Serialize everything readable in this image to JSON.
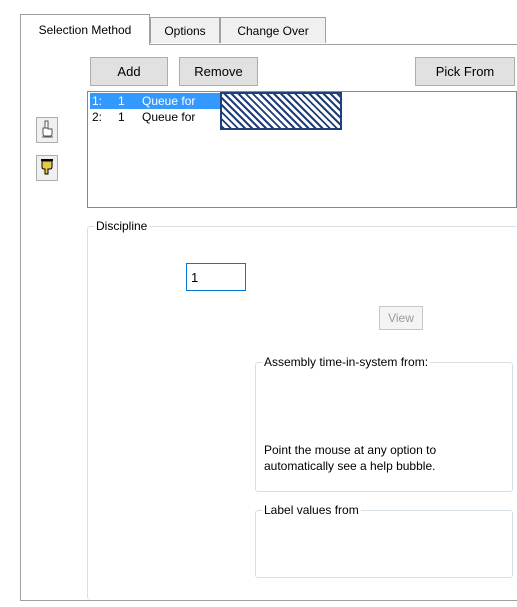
{
  "tabs": [
    {
      "label": "Selection Method",
      "active": true
    },
    {
      "label": "Options",
      "active": false
    },
    {
      "label": "Change Over",
      "active": false
    }
  ],
  "buttons": {
    "add": "Add",
    "remove": "Remove",
    "pick_from": "Pick From",
    "view": "View"
  },
  "list": {
    "rows": [
      {
        "num": "1:",
        "qty": "1",
        "name": "Queue for",
        "selected": true
      },
      {
        "num": "2:",
        "qty": "1",
        "name": "Queue for",
        "selected": false
      }
    ]
  },
  "icons": {
    "up": "hand-up-icon",
    "down": "hand-down-icon"
  },
  "discipline": {
    "label": "Discipline",
    "input_value": "1"
  },
  "assembly": {
    "label": "Assembly time-in-system from:",
    "help_text": "Point the mouse at any option to automatically see a help bubble."
  },
  "label_values": {
    "label": "Label values from"
  },
  "colors": {
    "selection": "#3399ff",
    "hatch": "#1e3f7a",
    "focus_border": "#0078d7"
  }
}
